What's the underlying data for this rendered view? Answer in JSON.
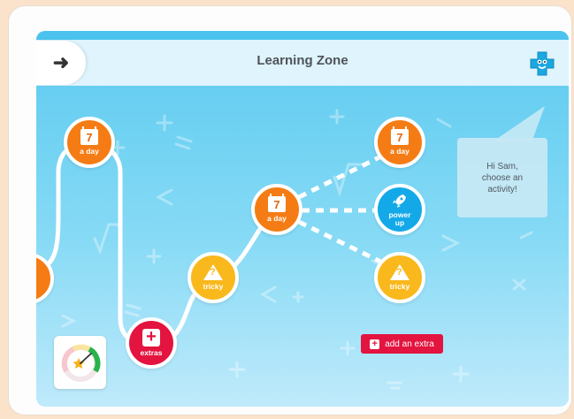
{
  "header": {
    "title": "Learning Zone",
    "back_glyph": "➜"
  },
  "icons": {
    "back": "arrow-right-icon",
    "mascot": "plus-mascot-icon",
    "gauge": "progress-gauge-icon"
  },
  "nodes": {
    "a_day_1": {
      "number": "7",
      "label": "a day"
    },
    "extras": {
      "label": "extras"
    },
    "tricky_1": {
      "glyph": "?",
      "label": "tricky"
    },
    "a_day_2": {
      "number": "7",
      "label": "a day"
    },
    "a_day_3": {
      "number": "7",
      "label": "a day"
    },
    "power_up": {
      "label": "power up"
    },
    "tricky_2": {
      "glyph": "?",
      "label": "tricky"
    }
  },
  "speech_bubble": {
    "text": "Hi Sam, choose an activity!"
  },
  "add_extra_button": {
    "label": "add an extra"
  },
  "colors": {
    "header_accent": "#4bc3ee",
    "orange": "#f57c14",
    "yellow": "#f9b81c",
    "red": "#e3143f",
    "blue": "#13a9e8"
  }
}
